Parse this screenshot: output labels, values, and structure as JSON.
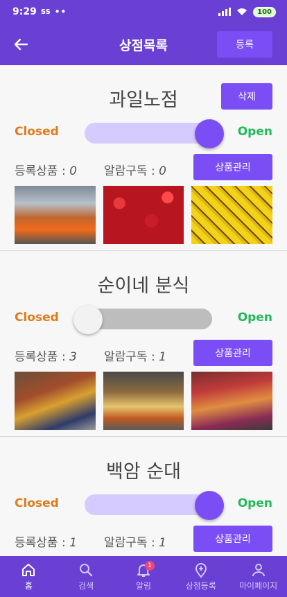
{
  "status": {
    "time": "9:29",
    "carrier_icon": "SS",
    "dots": "••",
    "battery": "100"
  },
  "appbar": {
    "title": "상점목록",
    "register_label": "등록"
  },
  "labels": {
    "closed": "Closed",
    "open": "Open",
    "products_prefix": "등록상품 : ",
    "alarm_prefix": "알람구독 : ",
    "delete": "삭제",
    "manage": "상품관리"
  },
  "stores": [
    {
      "name": "과일노점",
      "is_open": true,
      "products": "0",
      "alarms": "0",
      "show_delete": true,
      "photos": [
        "fruit-market-truck",
        "strawberries",
        "bananas"
      ]
    },
    {
      "name": "순이네 분식",
      "is_open": false,
      "products": "3",
      "alarms": "1",
      "show_delete": false,
      "photos": [
        "street-food-stall",
        "fried-skewers",
        "tteokbokki-stall"
      ]
    },
    {
      "name": "백암 순대",
      "is_open": true,
      "products": "1",
      "alarms": "1",
      "show_delete": false,
      "photos": []
    }
  ],
  "bottom_nav": [
    {
      "label": "홈",
      "icon": "home-icon",
      "active": true
    },
    {
      "label": "검색",
      "icon": "search-icon",
      "active": false
    },
    {
      "label": "알림",
      "icon": "bell-icon",
      "active": false,
      "badge": "1"
    },
    {
      "label": "상점등록",
      "icon": "map-pin-plus-icon",
      "active": false
    },
    {
      "label": "마이페이지",
      "icon": "person-icon",
      "active": false
    }
  ],
  "colors": {
    "primary": "#6a3fd4",
    "button": "#7b4ef5",
    "closed": "#e07b1a",
    "open": "#23b85a"
  }
}
